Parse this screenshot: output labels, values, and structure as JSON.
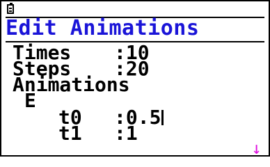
{
  "status": {
    "battery_icon": "battery-icon"
  },
  "title": "Edit Animations",
  "settings": {
    "times_label": "Times",
    "times_value": ":10",
    "steps_label": "Steps",
    "steps_value": ":20"
  },
  "animations": {
    "heading": "Animations",
    "target": "E",
    "rows": [
      {
        "label": "t0",
        "value": ":0.5"
      },
      {
        "label": "t1",
        "value": ":1"
      }
    ]
  },
  "scroll_indicator": "↓",
  "colors": {
    "title": "#1a14d8",
    "scroll_arrow": "#e010e0"
  }
}
